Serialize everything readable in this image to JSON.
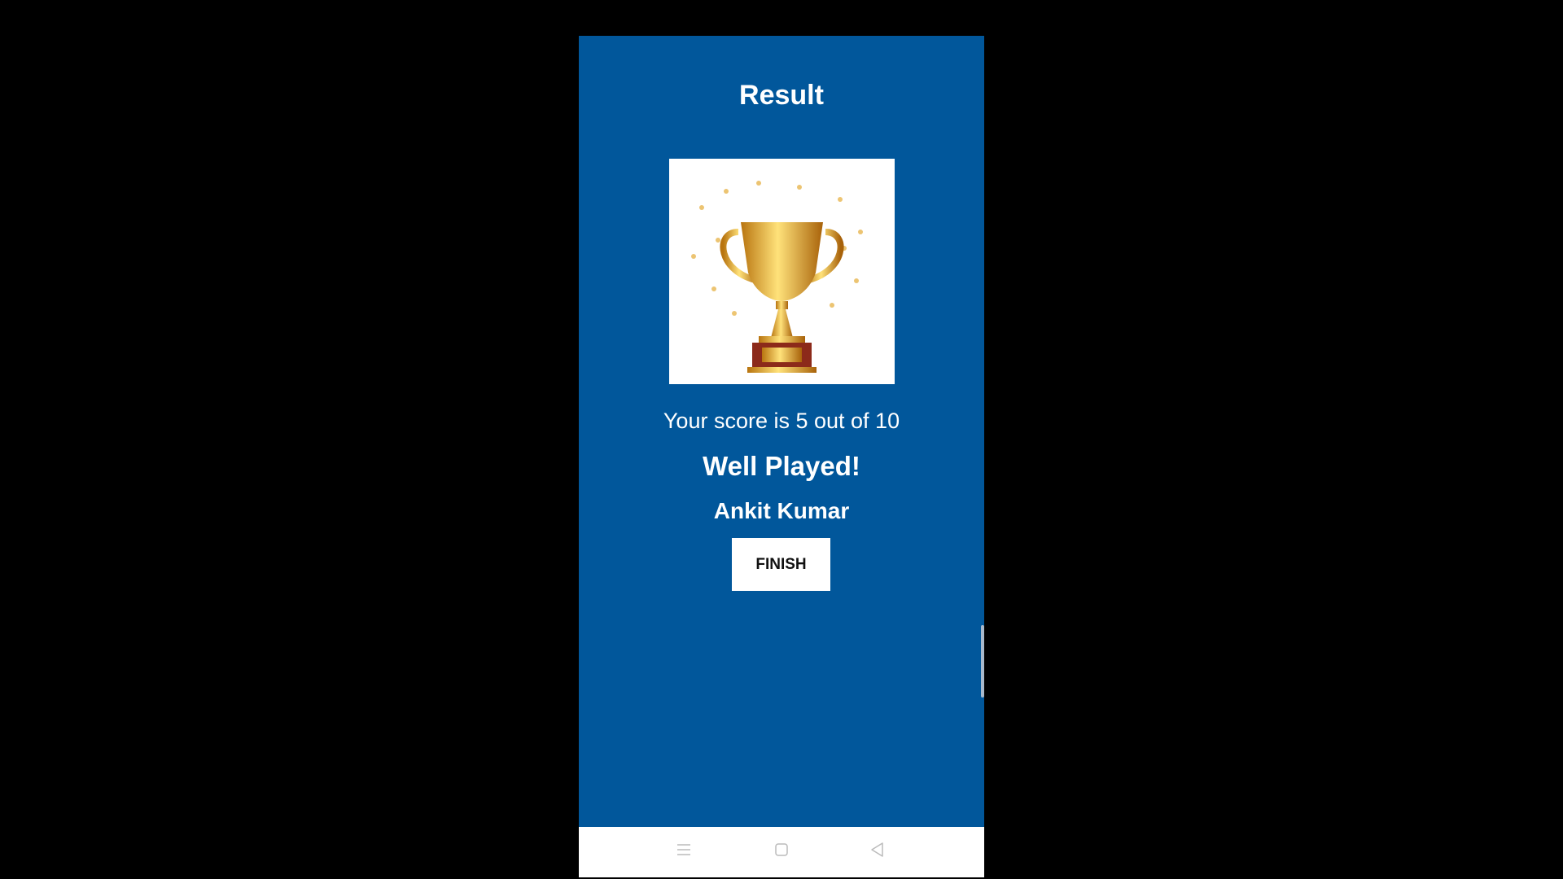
{
  "header": {
    "title": "Result"
  },
  "result": {
    "score_text": "Your score is 5 out of 10",
    "message": "Well Played!",
    "player_name": "Ankit Kumar",
    "finish_label": "FINISH"
  },
  "colors": {
    "background": "#01579b",
    "button": "#ffffff"
  },
  "nav_icons": [
    "menu-icon",
    "home-icon",
    "back-icon"
  ]
}
